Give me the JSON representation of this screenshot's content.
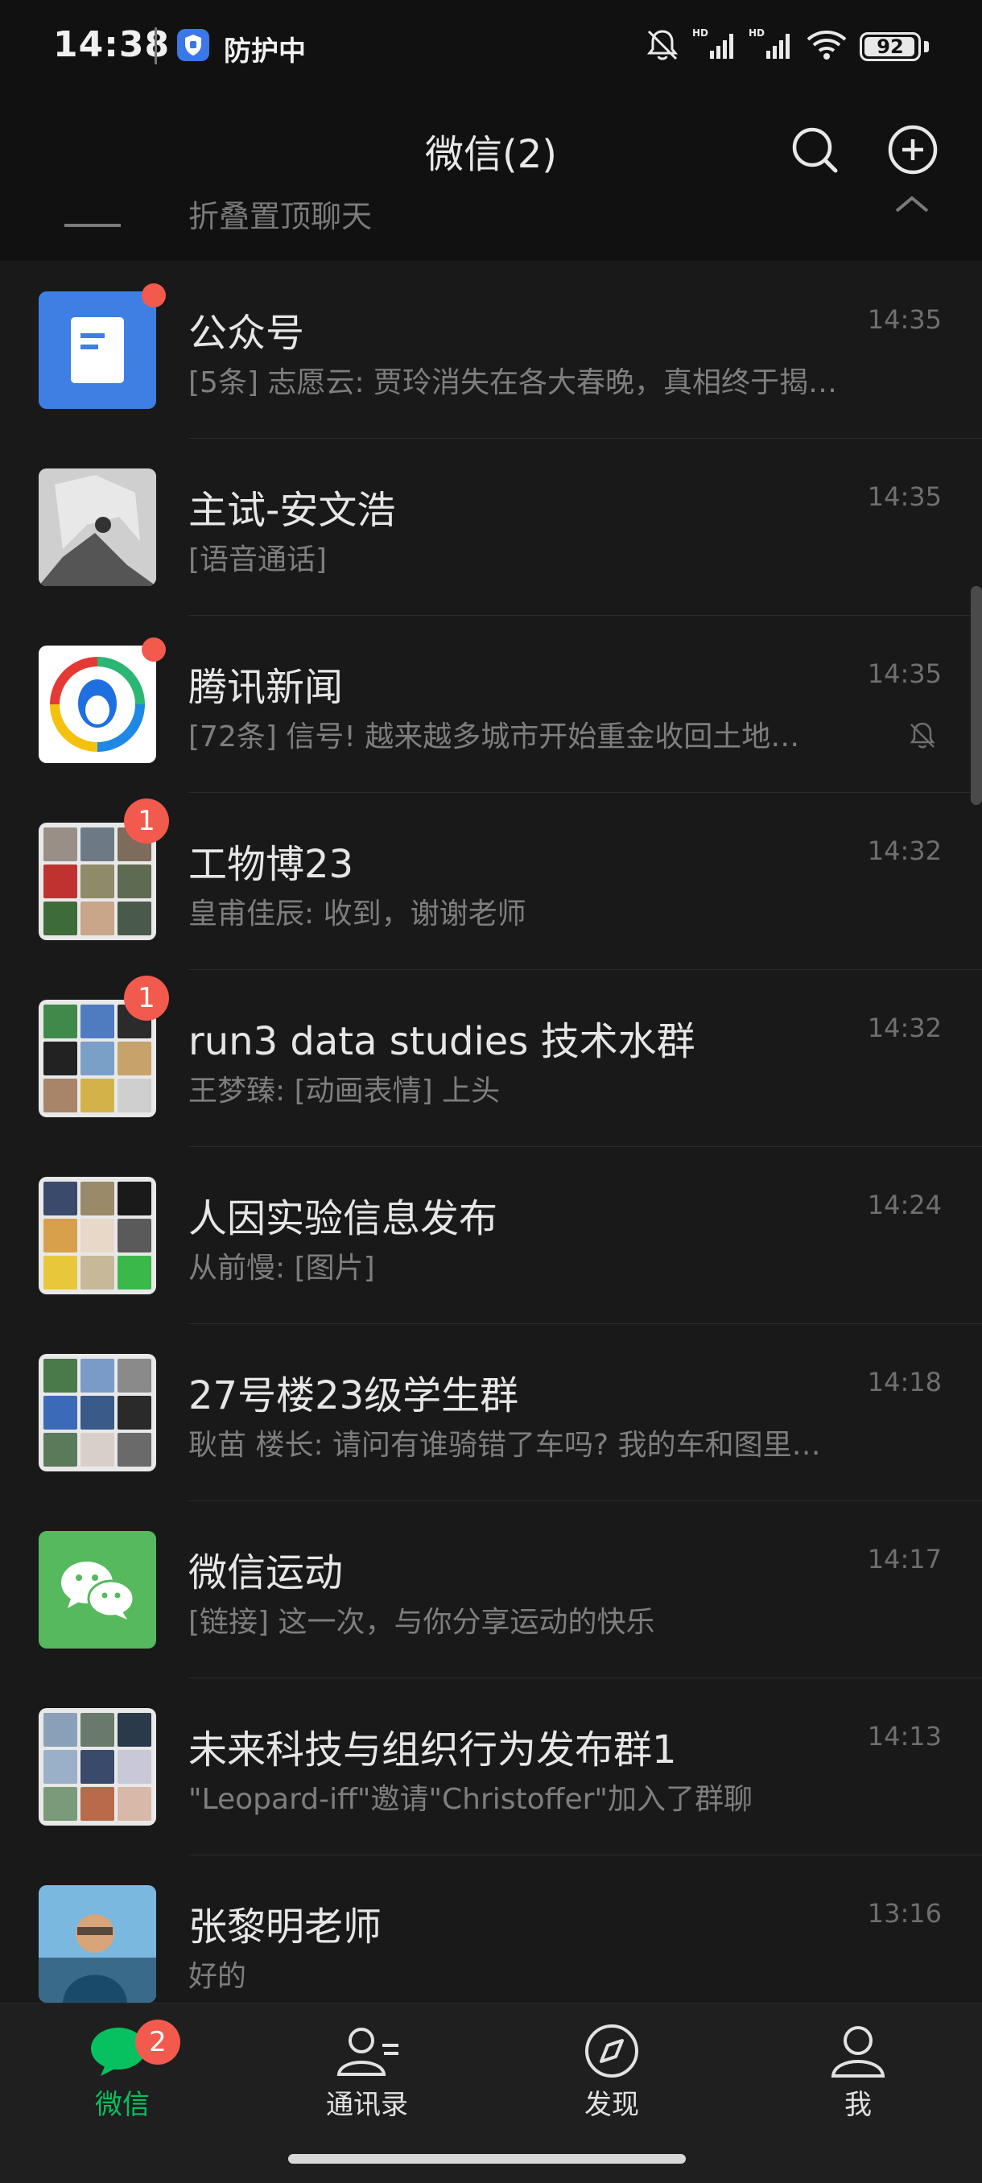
{
  "status_bar": {
    "time": "14:38",
    "protect_label": "防护中",
    "battery": "92",
    "signal_label": "HD",
    "icons": [
      "mute-icon",
      "signal-icon",
      "signal-icon",
      "wifi-icon",
      "battery-icon"
    ]
  },
  "header": {
    "title": "微信(2)",
    "icons": [
      "search-icon",
      "plus-circle-icon"
    ]
  },
  "pinned": {
    "label": "折叠置顶聊天"
  },
  "chats": [
    {
      "title": "公众号",
      "preview": "[5条] 志愿云: 贾玲消失在各大春晚，真相终于揭…",
      "time": "14:35",
      "unread_dot": true
    },
    {
      "title": "主试-安文浩",
      "preview": "[语音通话]",
      "time": "14:35"
    },
    {
      "title": "腾讯新闻",
      "preview": "[72条] 信号! 越来越多城市开始重金收回土地…",
      "time": "14:35",
      "unread_dot": true,
      "muted": true
    },
    {
      "title": "工物博23",
      "preview": "皇甫佳辰: 收到，谢谢老师",
      "time": "14:32",
      "badge": "1"
    },
    {
      "title": "run3 data studies 技术水群",
      "preview": "王梦臻: [动画表情] 上头",
      "time": "14:32",
      "badge": "1"
    },
    {
      "title": "人因实验信息发布",
      "preview": "从前慢: [图片]",
      "time": "14:24"
    },
    {
      "title": "27号楼23级学生群",
      "preview": "耿苗  楼长: 请问有谁骑错了车吗? 我的车和图里…",
      "time": "14:18"
    },
    {
      "title": "微信运动",
      "preview": "[链接] 这一次，与你分享运动的快乐",
      "time": "14:17"
    },
    {
      "title": "未来科技与组织行为发布群1",
      "preview": "\"Leopard-iff\"邀请\"Christoffer\"加入了群聊",
      "time": "14:13"
    },
    {
      "title": "张黎明老师",
      "preview": "好的",
      "time": "13:16"
    }
  ],
  "tabbar": {
    "tabs": [
      {
        "label": "微信",
        "badge": "2",
        "active": true
      },
      {
        "label": "通讯录"
      },
      {
        "label": "发现"
      },
      {
        "label": "我"
      }
    ]
  },
  "colors": {
    "accent_green": "#07c160",
    "badge_red": "#f25a4d",
    "background": "#191919"
  }
}
